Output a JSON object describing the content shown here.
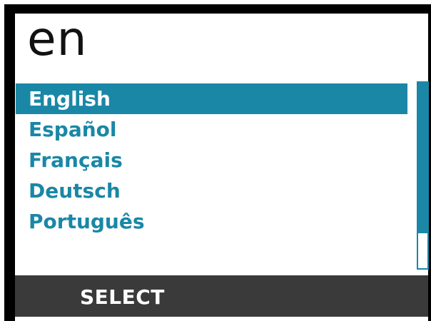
{
  "header": {
    "title": "en"
  },
  "language_list": {
    "items": [
      {
        "label": "English",
        "selected": true
      },
      {
        "label": "Español",
        "selected": false
      },
      {
        "label": "Français",
        "selected": false
      },
      {
        "label": "Deutsch",
        "selected": false
      },
      {
        "label": "Português",
        "selected": false
      }
    ]
  },
  "scrollbar": {
    "visible_fraction": 0.81,
    "position_fraction": 0.0
  },
  "softkey": {
    "select_label": "SELECT"
  },
  "colors": {
    "accent": "#1a87a6",
    "softkey_bar": "#3a3a3a",
    "background": "#ffffff",
    "bezel": "#000000"
  }
}
